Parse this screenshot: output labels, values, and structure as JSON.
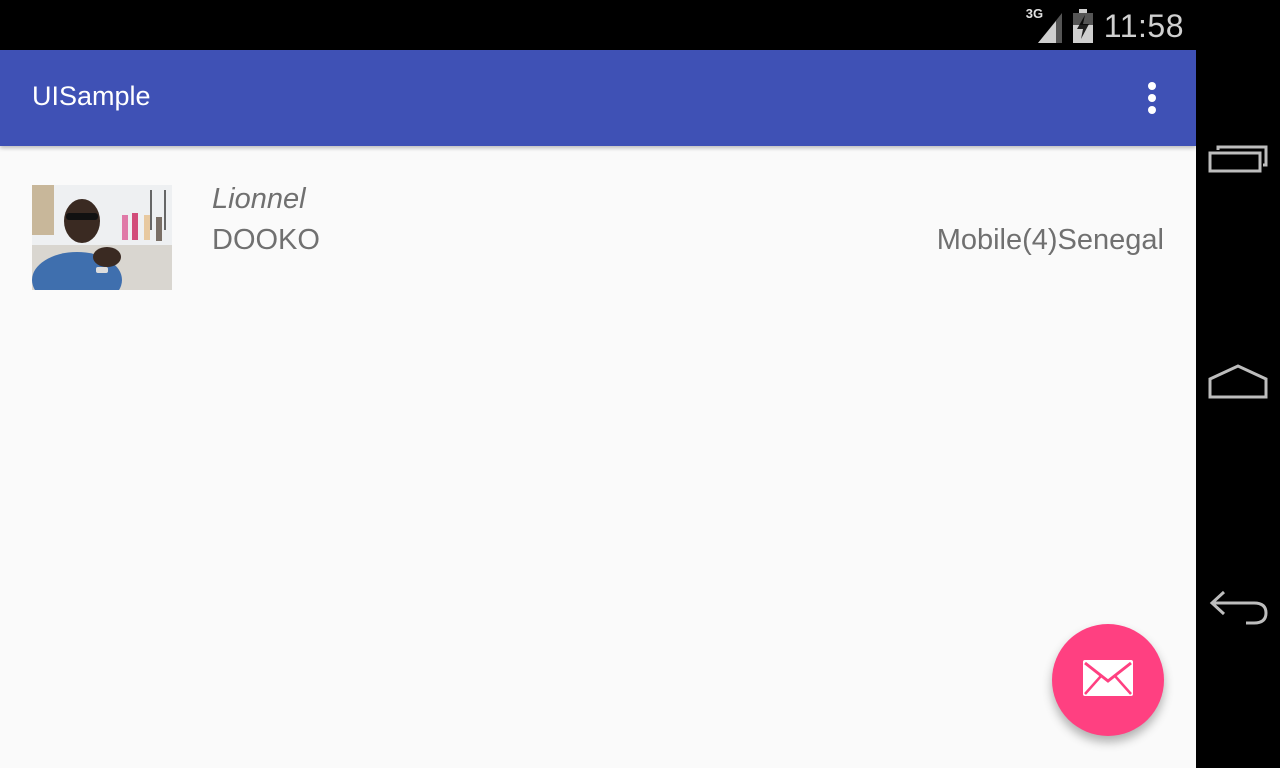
{
  "status_bar": {
    "network_label": "3G",
    "time": "11:58",
    "icons": [
      "signal-3g-icon",
      "battery-charging-icon"
    ]
  },
  "app": {
    "title": "UISample",
    "overflow_icon": "more-vert-icon",
    "colors": {
      "toolbar": "#3f51b5",
      "background": "#fafafa",
      "fab": "#ff4081",
      "secondary_text": "#707070"
    }
  },
  "list": {
    "items": [
      {
        "avatar": "person-photo",
        "first_name": "Lionnel",
        "last_name": "DOOKO",
        "meta": "Mobile(4)Senegal"
      }
    ]
  },
  "fab": {
    "icon": "mail-icon"
  },
  "nav_bar": {
    "buttons": [
      "recent-apps-icon",
      "home-icon",
      "back-icon"
    ]
  }
}
